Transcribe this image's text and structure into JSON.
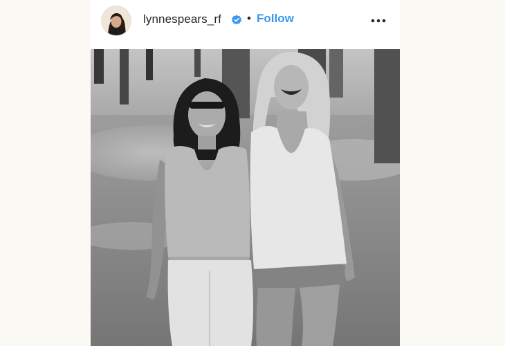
{
  "post": {
    "username": "lynnespears_rf",
    "separator": "•",
    "follow_label": "Follow",
    "verified_icon": "verified-badge-icon",
    "more_icon": "more-options-icon",
    "accent_color": "#3897f0",
    "photo": {
      "description_icon": "photo",
      "style": "black-and-white"
    }
  }
}
